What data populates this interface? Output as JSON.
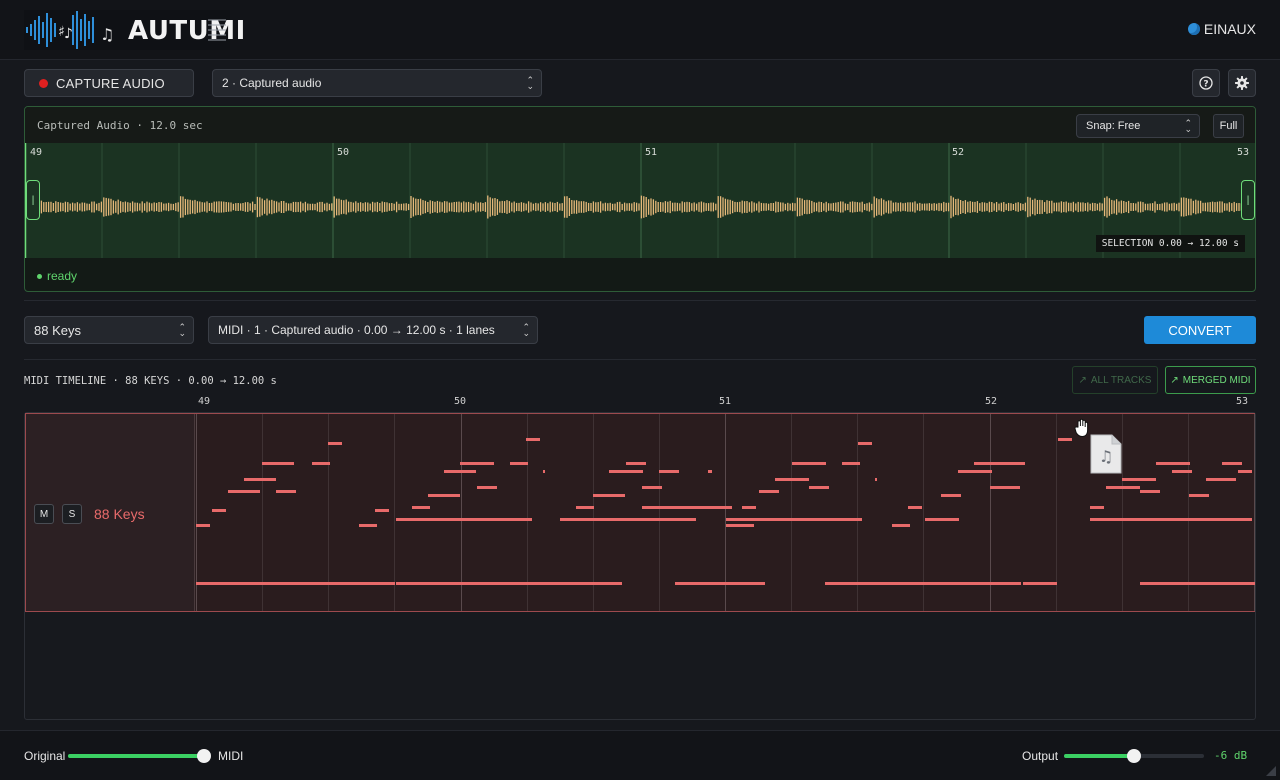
{
  "app": {
    "logo_text": "AUTUMI",
    "brand": "EINAUX",
    "colors": {
      "accent": "#1e8ad8",
      "green": "#5fd46c",
      "red": "#e86a6a",
      "wave": "#e6b87a"
    }
  },
  "toolbar": {
    "capture_label": "CAPTURE AUDIO",
    "audio_source": "2 · Captured audio",
    "help_icon": "help-circle-icon",
    "settings_icon": "gear-icon"
  },
  "audio_panel": {
    "title": "Captured Audio · 12.0 sec",
    "snap": "Snap: Free",
    "full_label": "Full",
    "bar_labels": [
      "49",
      "50",
      "51",
      "52",
      "53"
    ],
    "selection": "SELECTION 0.00 → 12.00 s",
    "status": "ready"
  },
  "conversion": {
    "instrument": "88 Keys",
    "midi_source": "MIDI · 1 · Captured audio · 0.00 → 12.00 s · 1 lanes",
    "convert_label": "CONVERT"
  },
  "timeline": {
    "title": "MIDI TIMELINE · 88 KEYS · 0.00 → 12.00 s",
    "all_tracks_label": "ALL TRACKS",
    "merged_midi_label": "MERGED MIDI",
    "ruler": [
      "49",
      "50",
      "51",
      "52",
      "53"
    ],
    "lane": {
      "mute": "M",
      "solo": "S",
      "name": "88 Keys"
    }
  },
  "footer": {
    "original_label": "Original",
    "midi_label": "MIDI",
    "mix_level": 1.0,
    "output_label": "Output",
    "output_level": 0.5,
    "output_value": "-6 dB"
  }
}
